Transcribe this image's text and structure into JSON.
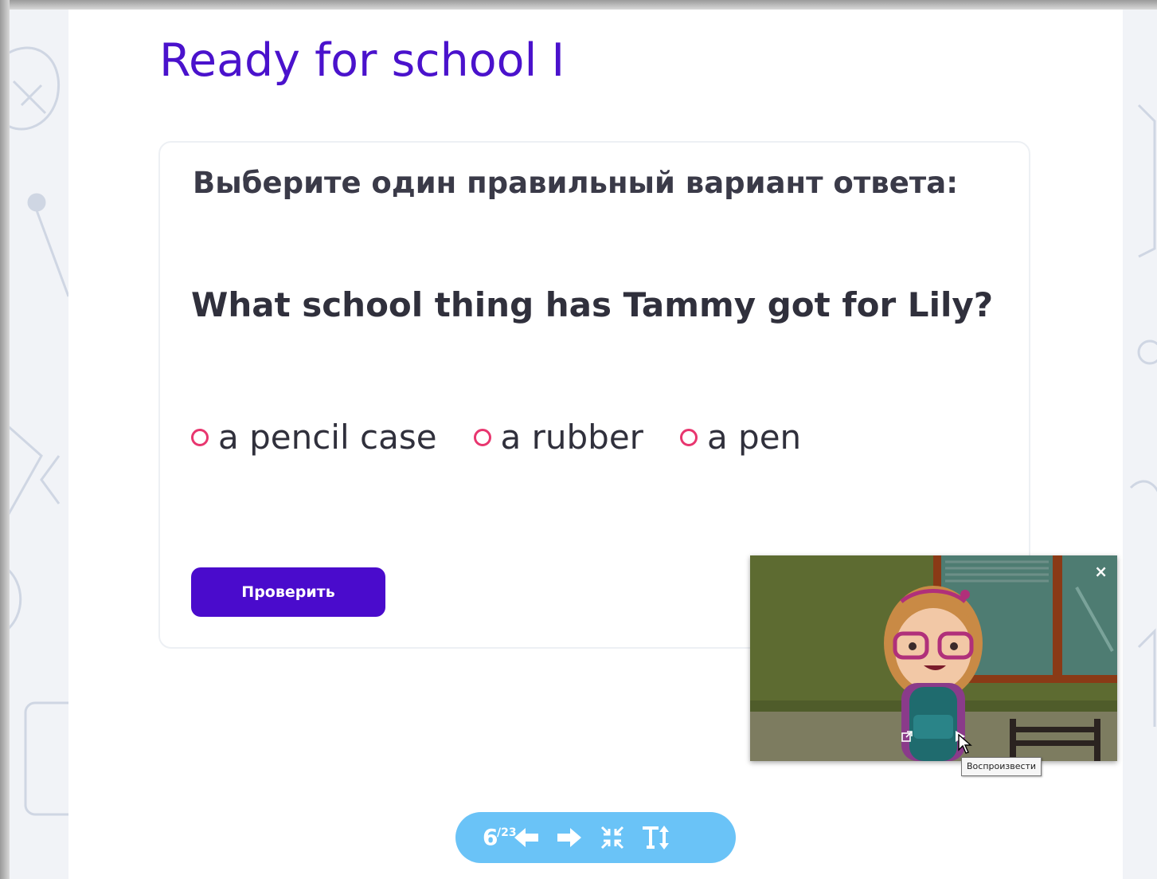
{
  "lesson": {
    "title": "Ready for school I"
  },
  "task": {
    "instruction": "Выберите один правильный вариант ответа:",
    "question": "What school thing has Tammy got for Lily?",
    "options": [
      {
        "label": "a pencil case",
        "selected": false
      },
      {
        "label": "a rubber",
        "selected": false
      },
      {
        "label": "a pen",
        "selected": false
      }
    ],
    "check_label": "Проверить"
  },
  "video_player": {
    "close_label": "×",
    "tooltip": "Воспроизвести",
    "icons": {
      "close": "close-icon",
      "popout": "external-link-icon",
      "play": "play-icon"
    }
  },
  "toolbar": {
    "slide_number": "6",
    "slide_total": "/23",
    "icons": [
      "arrow-left-icon",
      "arrow-right-icon",
      "collapse-icon",
      "text-size-icon"
    ]
  },
  "colors": {
    "title": "#4a12cc",
    "accent": "#4a0bcc",
    "radio": "#e8366f",
    "toolbar": "#6ac3f7"
  }
}
